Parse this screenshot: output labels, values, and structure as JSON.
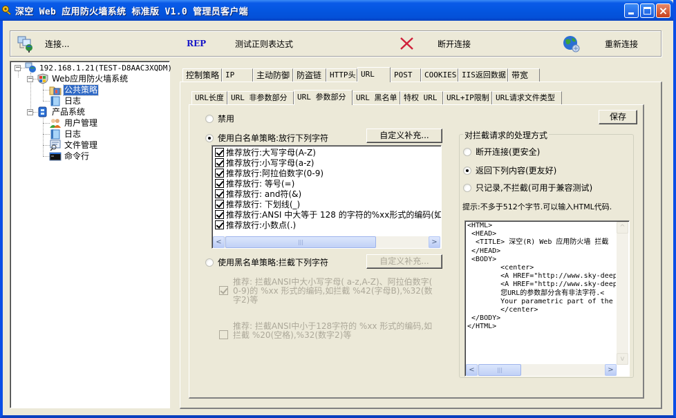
{
  "window": {
    "title": "深空 Web 应用防火墙系统 标准版 V1.0 管理员客户端",
    "controls": {
      "minimize": "minimize",
      "maximize": "maximize",
      "close": "×"
    }
  },
  "toolbar": {
    "items": [
      {
        "icon": "network-connect-icon",
        "label": "连接..."
      },
      {
        "icon": "rep-icon",
        "icon_text": "REP",
        "label": "测试正则表达式"
      },
      {
        "icon": "red-x-icon",
        "label": "断开连接"
      },
      {
        "icon": "globe-reconnect-icon",
        "label": "重新连接"
      }
    ]
  },
  "tree": {
    "nodes": [
      {
        "label": "192.168.1.21(TEST-D8AAC3XQDM)",
        "icon": "computer-network-icon",
        "level": 0,
        "expanded": true
      },
      {
        "label": "Web应用防火墙系统",
        "icon": "shield-icon",
        "level": 1,
        "expanded": true
      },
      {
        "label": "公共策略",
        "icon": "policy-folder-icon",
        "level": 2,
        "selected": true
      },
      {
        "label": "日志",
        "icon": "log-icon",
        "level": 2
      },
      {
        "label": "产品系统",
        "icon": "product-system-icon",
        "level": 1,
        "expanded": true
      },
      {
        "label": "用户管理",
        "icon": "users-icon",
        "level": 2
      },
      {
        "label": "日志",
        "icon": "log-icon",
        "level": 2
      },
      {
        "label": "文件管理",
        "icon": "file-manager-icon",
        "level": 2
      },
      {
        "label": "命令行",
        "icon": "terminal-icon",
        "level": 2
      }
    ]
  },
  "outer_tabs": {
    "items": [
      "控制策略",
      "IP",
      "主动防御",
      "防盗链",
      "HTTP头",
      "URL",
      "POST",
      "COOKIES",
      "IIS返回数据",
      "带宽"
    ],
    "active": "URL"
  },
  "inner_tabs": {
    "items": [
      "URL长度",
      "URL 非参数部分",
      "URL 参数部分",
      "URL 黑名单",
      "特权 URL",
      "URL+IP限制",
      "URL请求文件类型"
    ],
    "active": "URL 参数部分"
  },
  "policy": {
    "disable_label": "禁用",
    "whitelist_label": "使用白名单策略:放行下列字符",
    "whitelist_custom_button": "自定义补充...",
    "selected_mode": "whitelist",
    "whitelist_items": [
      {
        "label": "推荐放行:大写字母(A-Z)",
        "checked": true
      },
      {
        "label": "推荐放行:小写字母(a-z)",
        "checked": true
      },
      {
        "label": "推荐放行:阿拉伯数字(0-9)",
        "checked": true
      },
      {
        "label": "推荐放行: 等号(=)",
        "checked": true
      },
      {
        "label": "推荐放行: and符(&)",
        "checked": true
      },
      {
        "label": "推荐放行: 下划线(_)",
        "checked": true
      },
      {
        "label": "推荐放行:ANSI 中大等于 128 的字符的%xx形式的编码(如前",
        "checked": true
      },
      {
        "label": "推荐放行:小数点(.)",
        "checked": true
      }
    ],
    "blacklist_label": "使用黑名单策略:拦截下列字符",
    "blacklist_custom_button": "自定义补充...",
    "blacklist_items": [
      {
        "label": "推荐: 拦截ANSI中大小写字母( a-z,A-Z)、阿拉伯数字( 0-9)的 %xx 形式的编码,如拦截 %42(字母B),%32(数字2)等",
        "checked": true,
        "enabled": false
      },
      {
        "label": "推荐: 拦截ANSI中小于128字符的 %xx 形式的编码,如拦截 %20(空格),%32(数字2)等",
        "checked": false,
        "enabled": false
      }
    ]
  },
  "save_button": "保存",
  "handling": {
    "title": "对拦截请求的处理方式",
    "options": [
      {
        "label": "断开连接(更安全)",
        "selected": false
      },
      {
        "label": "返回下列内容(更友好)",
        "selected": true
      },
      {
        "label": "只记录,不拦截(可用于兼容测试)",
        "selected": false
      }
    ],
    "hint": "提示:不多于512个字节.可以输入HTML代码.",
    "response_html": [
      "<HTML>",
      " <HEAD>",
      "  <TITLE> 深空(R) Web 应用防火墙 拦截",
      " </HEAD>",
      " <BODY>",
      "        <center>",
      "        <A HREF=\"http://www.sky-deep.",
      "        <A HREF=\"http://www.sky-deep.",
      "        您URL的参数部分含有非法字符.<",
      "        Your parametric part of the U",
      "        </center>",
      " </BODY>",
      "</HTML>"
    ]
  },
  "scrollbar": {
    "thumb_glyph": "|||",
    "left": "<",
    "right": ">",
    "up": "^",
    "down": "v"
  }
}
